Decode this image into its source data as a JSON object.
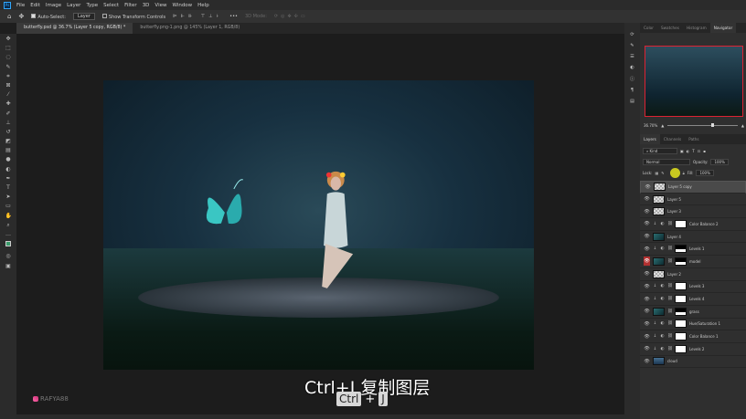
{
  "menubar": {
    "app_icon": "Ps",
    "items": [
      "File",
      "Edit",
      "Image",
      "Layer",
      "Type",
      "Select",
      "Filter",
      "3D",
      "View",
      "Window",
      "Help"
    ]
  },
  "options": {
    "auto_select": "Auto-Select:",
    "auto_select_target": "Layer",
    "show_transform": "Show Transform Controls",
    "mode_3d": "3D Mode:"
  },
  "doc_tabs": [
    {
      "label": "butterfly.psd @ 36.7% (Layer 5 copy, RGB/8) *",
      "active": true
    },
    {
      "label": "butterfly.png-1.png @ 145% (Layer 1, RGB/8)",
      "active": false
    }
  ],
  "panel": {
    "top_tabs": [
      "Color",
      "Swatches",
      "Histogram",
      "Navigator"
    ],
    "active_top_tab": "Navigator",
    "zoom": "36.70%",
    "layer_tabs": [
      "Layers",
      "Channels",
      "Paths"
    ],
    "filter_kind": "Kind",
    "blend_mode": "Normal",
    "opacity_label": "Opacity:",
    "opacity": "100%",
    "lock_label": "Lock:",
    "fill_label": "Fill:",
    "fill": "100%",
    "layers": [
      {
        "name": "Layer 5 copy",
        "type": "pixel",
        "selected": true
      },
      {
        "name": "Layer 5",
        "type": "pixel"
      },
      {
        "name": "Layer 3",
        "type": "pixel"
      },
      {
        "name": "Color Balance 2",
        "type": "adjustment"
      },
      {
        "name": "Layer 4",
        "type": "image"
      },
      {
        "name": "Levels 1",
        "type": "adjustment",
        "mask": "dark"
      },
      {
        "name": "model",
        "type": "image",
        "mask": "dark",
        "eye_highlight": true
      },
      {
        "name": "Layer 2",
        "type": "pixel"
      },
      {
        "name": "Levels 3",
        "type": "adjustment"
      },
      {
        "name": "Levels 4",
        "type": "adjustment"
      },
      {
        "name": "grass",
        "type": "image",
        "mask": "dark"
      },
      {
        "name": "Hue/Saturation 1",
        "type": "adjustment"
      },
      {
        "name": "Color Balance 1",
        "type": "adjustment"
      },
      {
        "name": "Levels 2",
        "type": "adjustment"
      },
      {
        "name": "cloud",
        "type": "sky"
      }
    ]
  },
  "overlay": {
    "subtitle": "Ctrl+J 复制图层",
    "key1": "Ctrl",
    "plus": "+",
    "key2": "J",
    "watermark": "RAFYA88"
  }
}
